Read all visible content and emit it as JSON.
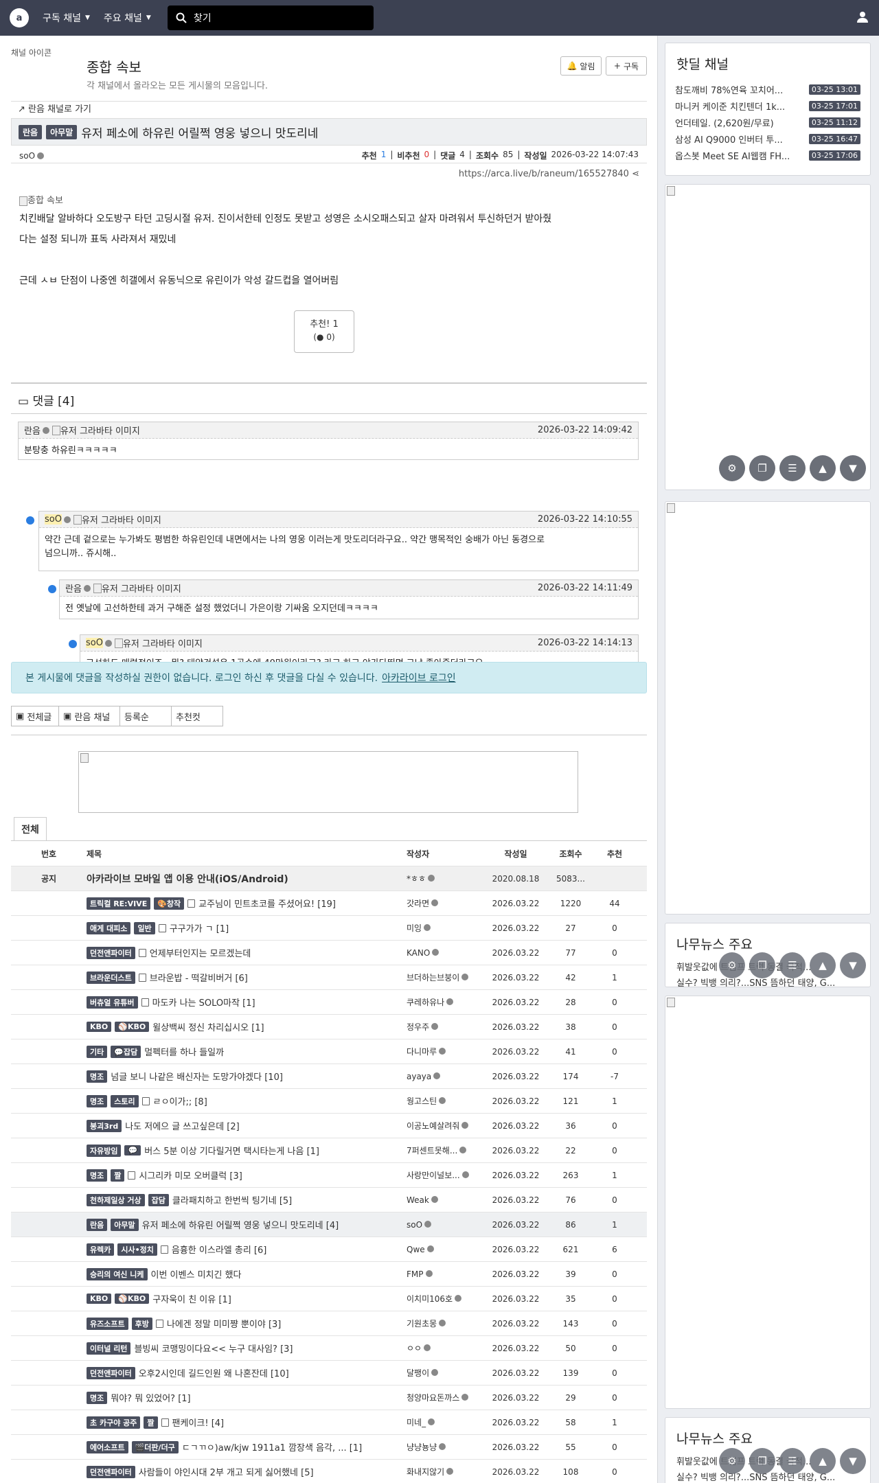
{
  "topbar": {
    "sub_label": "구독 채널",
    "main_label": "주요 채널",
    "search_placeholder": "찾기"
  },
  "channel": {
    "thumb_alt": "채널 아이콘",
    "title": "종합 속보",
    "desc": "각 채널에서 올라오는 모든 게시물의 모음입니다.",
    "alert_label": "알림",
    "subscribe_label": "구독"
  },
  "post": {
    "goto_label": "란음 채널로 가기",
    "badge1": "란음",
    "badge2": "아무말",
    "title": "유저 페소에 하유린 어릴쩍 영웅 넣으니 맛도리네",
    "author": "soO",
    "rec_label": "추천",
    "rec": "1",
    "unrec_label": "비추천",
    "unrec": "0",
    "cmt_label": "댓글",
    "cmt": "4",
    "view_label": "조회수",
    "view": "85",
    "date_label": "작성일",
    "date": "2026-03-22 14:07:43",
    "url": "https://arca.live/b/raneum/165527840",
    "img_alt": "종합 속보",
    "line1": "치킨배달 알바하다 오도방구 타던 고딩시절 유저. 진이서한테 인정도 못받고 성영은 소시오패스되고 살자 마려워서 투신하던거 받아줬",
    "line2": "다는 설정 되니까 표독 사라져서 재밌네",
    "line3": "근데 ㅅㅂ 단점이 나중엔 히갤에서 유동닉으로 유린이가 악성 갈드컵을 열어버림",
    "rec_btn": "추천! 1",
    "rec_btn_sub": "0"
  },
  "comments": {
    "header": "댓글 [4]",
    "avatar_alt": "유저 그라바타 이미지",
    "items": [
      {
        "author": "란음",
        "time": "2026-03-22 14:09:42",
        "text": "분탕충 하유린ㅋㅋㅋㅋㅋ"
      },
      {
        "author": "soO",
        "time": "2026-03-22 14:10:55",
        "text": "약간 근데 겉으로는 누가봐도 평범한 하유린인데 내면에서는 나의 영웅 이러는게 맛도리더라구요.. 약간 맹목적인 숭배가 아닌 동경으로",
        "text2": "넘으니까.. 쥬시해.."
      },
      {
        "author": "란음",
        "time": "2026-03-22 14:11:49",
        "text": "전 옛날에 고선하한테 과거 구해준 설정 했었더니 가은이랑 기싸움 오지던데ㅋㅋㅋㅋ"
      },
      {
        "author": "soO",
        "time": "2026-03-22 14:14:13",
        "text": "고선하도 매력적이죠.. 뭐? 태양건설은 1공수에 40만원이라고? 라고 하고 야가다뛰면 그냥 좋아죽더라고요"
      }
    ],
    "login_notice": "본 게시물에 댓글을 작성하실 권한이 없습니다. 로그인 하신 후 댓글을 다실 수 있습니다.",
    "login_link": "아카라이브 로그인"
  },
  "filters": [
    "전체글",
    "란음 채널",
    "등록순",
    "추천컷"
  ],
  "list": {
    "tab": "전체",
    "headers": {
      "no": "번호",
      "title": "제목",
      "author": "작성자",
      "date": "작성일",
      "views": "조회수",
      "rec": "추천"
    },
    "notice": {
      "no": "공지",
      "title": "아카라이브 모바일 앱 이용 안내(iOS/Android)",
      "author": "*ㅎㅎ",
      "date": "2020.08.18",
      "views": "5083...",
      "rec": ""
    },
    "rows": [
      {
        "b1": "트릭컬 RE:VIVE",
        "b2": "🎨창작",
        "doc": true,
        "title": "교주님이 민트초코를 주셨어요! [19]",
        "author": "갓라면",
        "date": "2026.03.22",
        "views": "1220",
        "rec": "44"
      },
      {
        "b1": "애게 대피소",
        "b2": "일반",
        "doc": true,
        "title": "구구가가 ㄱ [1]",
        "author": "미잉",
        "date": "2026.03.22",
        "views": "27",
        "rec": "0"
      },
      {
        "b1": "던전앤파이터",
        "b2": "",
        "doc": true,
        "title": "언제부터인지는 모르겠는데",
        "author": "KANO",
        "date": "2026.03.22",
        "views": "77",
        "rec": "0"
      },
      {
        "b1": "브라운더스트",
        "b2": "",
        "doc": true,
        "title": "브라운밥 - 떡갈비버거 [6]",
        "author": "브더하는브붕이",
        "date": "2026.03.22",
        "views": "42",
        "rec": "1"
      },
      {
        "b1": "버츄얼 유튜버",
        "b2": "",
        "doc": true,
        "title": "마도카 나는 SOLO마작 [1]",
        "author": "쿠레하유나",
        "date": "2026.03.22",
        "views": "28",
        "rec": "0"
      },
      {
        "b1": "KBO",
        "b2": "⚾KBO",
        "doc": false,
        "title": "윌상백씨 정신 차리십시오 [1]",
        "author": "정우주",
        "date": "2026.03.22",
        "views": "38",
        "rec": "0"
      },
      {
        "b1": "기타",
        "b2": "💬잡담",
        "doc": false,
        "title": "멀펙터를 하나 들일까",
        "author": "다니마루",
        "date": "2026.03.22",
        "views": "41",
        "rec": "0"
      },
      {
        "b1": "명조",
        "b2": "",
        "doc": false,
        "title": "넘글 보니 나같은 배신자는 도망가야겠다 [10]",
        "author": "ayaya",
        "date": "2026.03.22",
        "views": "174",
        "rec": "-7"
      },
      {
        "b1": "명조",
        "b2": "스토리",
        "doc": true,
        "title": "ㄹㅇ이가;; [8]",
        "author": "웡고스틴",
        "date": "2026.03.22",
        "views": "121",
        "rec": "1"
      },
      {
        "b1": "붕괴3rd",
        "b2": "",
        "doc": false,
        "title": "나도 저에으 글 쓰고싶은데 [2]",
        "author": "이공노예살려줘",
        "date": "2026.03.22",
        "views": "36",
        "rec": "0"
      },
      {
        "b1": "자유방임",
        "b2": "💬",
        "doc": false,
        "title": "버스 5분 이상 기다릴거면 택시타는게 나음 [1]",
        "author": "7퍼센트못해...",
        "date": "2026.03.22",
        "views": "22",
        "rec": "0"
      },
      {
        "b1": "명조",
        "b2": "짤",
        "doc": true,
        "title": "시그리카 미모 오버클럭 [3]",
        "author": "사랑만이널보...",
        "date": "2026.03.22",
        "views": "263",
        "rec": "1"
      },
      {
        "b1": "천하제일상 거상",
        "b2": "잡담",
        "doc": false,
        "title": "클라패치하고 한번씩 팅기네 [5]",
        "author": "Weak",
        "date": "2026.03.22",
        "views": "76",
        "rec": "0"
      },
      {
        "b1": "란음",
        "b2": "아무말",
        "doc": false,
        "title": "유저 페소에 하유린 어릴쩍 영웅 넣으니 맛도리네 [4]",
        "author": "soO",
        "date": "2026.03.22",
        "views": "86",
        "rec": "1",
        "current": true
      },
      {
        "b1": "유렉카",
        "b2": "시사•정치",
        "doc": true,
        "title": "음흉한 이스라엘 총리 [6]",
        "author": "Qwe",
        "date": "2026.03.22",
        "views": "621",
        "rec": "6"
      },
      {
        "b1": "승리의 여신 니케",
        "b2": "",
        "doc": false,
        "title": "이번 이벤스 미치긴 했다",
        "author": "FMP",
        "date": "2026.03.22",
        "views": "39",
        "rec": "0"
      },
      {
        "b1": "KBO",
        "b2": "⚾KBO",
        "doc": false,
        "title": "구자욱이 친 이유 [1]",
        "author": "이치미106호",
        "date": "2026.03.22",
        "views": "35",
        "rec": "0"
      },
      {
        "b1": "유즈소프트",
        "b2": "후방",
        "doc": true,
        "title": "나에겐 정말 미미쨩 뿐이야 [3]",
        "author": "기원초몽",
        "date": "2026.03.22",
        "views": "143",
        "rec": "0"
      },
      {
        "b1": "이터널 리턴",
        "b2": "",
        "doc": false,
        "title": "블빙씨 코맹밍이다요<< 누구 대사임? [3]",
        "author": "ㅇㅇ",
        "date": "2026.03.22",
        "views": "50",
        "rec": "0"
      },
      {
        "b1": "던전앤파이터",
        "b2": "",
        "doc": false,
        "title": "오후2시인데 길드인원 왜 나혼잔데 [10]",
        "author": "달팽이",
        "date": "2026.03.22",
        "views": "139",
        "rec": "0"
      },
      {
        "b1": "명조",
        "b2": "",
        "doc": false,
        "title": "뭐야? 뭐 있었어? [1]",
        "author": "청양마요돈까스",
        "date": "2026.03.22",
        "views": "29",
        "rec": "0"
      },
      {
        "b1": "초 카구야 공주",
        "b2": "짤",
        "doc": true,
        "title": "팬케이크! [4]",
        "author": "미네_",
        "date": "2026.03.22",
        "views": "58",
        "rec": "1"
      },
      {
        "b1": "에어소프트",
        "b2": "🎬더판/더구",
        "doc": false,
        "title": "ㄷㄱㄲㅇ)aw/kjw 1911a1 깜장색 음각, ... [1]",
        "author": "냥냥뇽냥",
        "date": "2026.03.22",
        "views": "55",
        "rec": "0"
      },
      {
        "b1": "던전앤파이터",
        "b2": "",
        "doc": false,
        "title": "사람들이 야인시대 2부 개고 되게 싫어했네 [5]",
        "author": "화내지않기",
        "date": "2026.03.22",
        "views": "108",
        "rec": "0"
      }
    ]
  },
  "sidebar": {
    "hot_title": "핫딜 채널",
    "hot": [
      {
        "t": "참도깨비 78%연육 꼬치어...",
        "d": "03-25 13:01"
      },
      {
        "t": "마니커 케이준 치킨텐더 1k...",
        "d": "03-25 17:01"
      },
      {
        "t": "언더테일. (2,620원/무료)",
        "d": "03-25 11:12"
      },
      {
        "t": "삼성 AI Q9000 인버터 투...",
        "d": "03-25 16:47"
      },
      {
        "t": "옵스봇 Meet SE AI웹캠 FH...",
        "d": "03-25 17:06"
      }
    ],
    "news_title": "나무뉴스 주요",
    "news1": "휘발웃값에 트럼프 트럭 동결 극적...",
    "news2": "실수? 빅뱅 의리?...SNS 뜸하던 태양, G..."
  }
}
